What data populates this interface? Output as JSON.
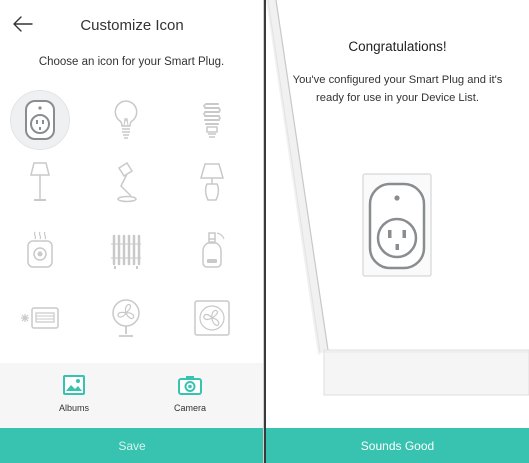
{
  "customize": {
    "title": "Customize Icon",
    "subtitle": "Choose an icon for your Smart Plug.",
    "icons": [
      {
        "name": "smart-plug",
        "selected": true
      },
      {
        "name": "light-bulb",
        "selected": false
      },
      {
        "name": "cfl-bulb",
        "selected": false
      },
      {
        "name": "floor-lamp",
        "selected": false
      },
      {
        "name": "desk-lamp",
        "selected": false
      },
      {
        "name": "table-lamp",
        "selected": false
      },
      {
        "name": "kettle",
        "selected": false
      },
      {
        "name": "radiator-heater",
        "selected": false
      },
      {
        "name": "humidifier",
        "selected": false
      },
      {
        "name": "air-conditioner",
        "selected": false
      },
      {
        "name": "fan",
        "selected": false
      },
      {
        "name": "exhaust-fan",
        "selected": false
      }
    ],
    "albums_label": "Albums",
    "camera_label": "Camera",
    "save_label": "Save"
  },
  "congrats": {
    "title": "Congratulations!",
    "message_line1": "You've configured your Smart Plug and it's",
    "message_line2": "ready for use in your Device List.",
    "button_label": "Sounds Good"
  },
  "colors": {
    "accent": "#37c3b0",
    "icon_stroke": "#c9c9c9",
    "icon_selected": "#8a8d90"
  }
}
